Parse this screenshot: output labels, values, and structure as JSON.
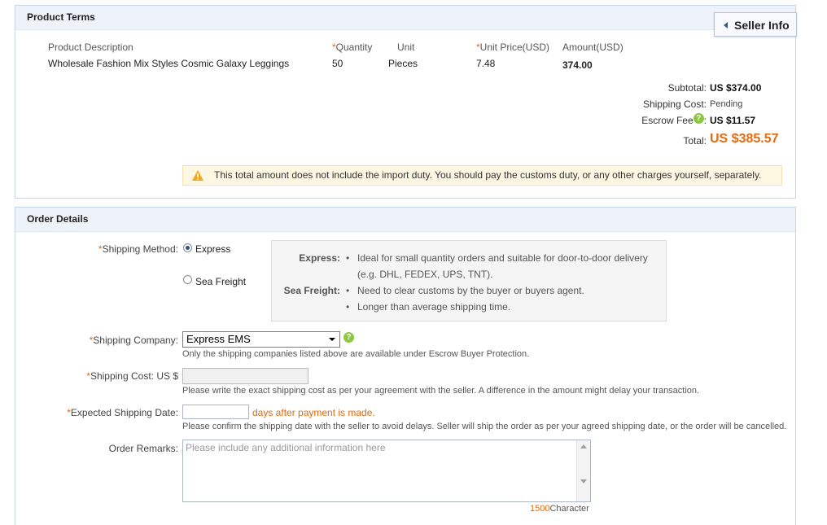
{
  "product_terms": {
    "title": "Product Terms",
    "seller_info_label": "Seller Info",
    "columns": {
      "description": "Product Description",
      "quantity": "Quantity",
      "unit": "Unit",
      "unit_price": "Unit Price(USD)",
      "amount": "Amount(USD)"
    },
    "row": {
      "description": "Wholesale Fashion Mix Styles Cosmic Galaxy Leggings",
      "quantity": "50",
      "unit": "Pieces",
      "unit_price": "7.48",
      "amount": "374.00"
    },
    "summary": {
      "subtotal_label": "Subtotal:",
      "subtotal_value": "US $374.00",
      "shipping_label": "Shipping Cost:",
      "shipping_value": "Pending",
      "escrow_label": "Escrow Fee",
      "escrow_colon": ":",
      "escrow_value": "US $11.57",
      "total_label": "Total:",
      "total_value": "US $385.57"
    },
    "warning": "This total amount does not include the import duty. You should pay the customs duty, or any other charges yourself, separately."
  },
  "order_details": {
    "title": "Order Details",
    "required_mark": "*",
    "shipping_method": {
      "label": "Shipping Method:",
      "options": [
        "Express",
        "Sea Freight"
      ],
      "selected": "Express",
      "info": {
        "express_label": "Express:",
        "express_lines": [
          "Ideal for small quantity orders and suitable for door-to-door delivery",
          "(e.g. DHL, FEDEX, UPS, TNT)."
        ],
        "sea_label": "Sea Freight:",
        "sea_lines": [
          "Need to clear customs by the buyer or buyers agent.",
          "Longer than average shipping time."
        ],
        "bullet": "•"
      }
    },
    "shipping_company": {
      "label": "Shipping Company:",
      "selected": "Express EMS",
      "hint": "Only the shipping companies listed above are available under Escrow Buyer Protection."
    },
    "shipping_cost": {
      "label": "Shipping Cost: US $",
      "value": "",
      "hint": "Please write the exact shipping cost as per your agreement with the seller. A difference in the amount might delay your transaction."
    },
    "expected_date": {
      "label": "Expected Shipping Date:",
      "value": "",
      "suffix": "days after payment is made.",
      "hint": "Please confirm the shipping date with the seller to avoid delays. Seller will ship the order as per your agreed shipping date, or the order will be cancelled."
    },
    "remarks": {
      "label": "Order Remarks:",
      "placeholder": "Please include any additional information here",
      "counter_value": "1500",
      "counter_unit": "Character"
    }
  },
  "colors": {
    "accent_orange": "#e8690c",
    "header_bg": "#eef3f9",
    "border_blue": "#c5d6e6"
  }
}
